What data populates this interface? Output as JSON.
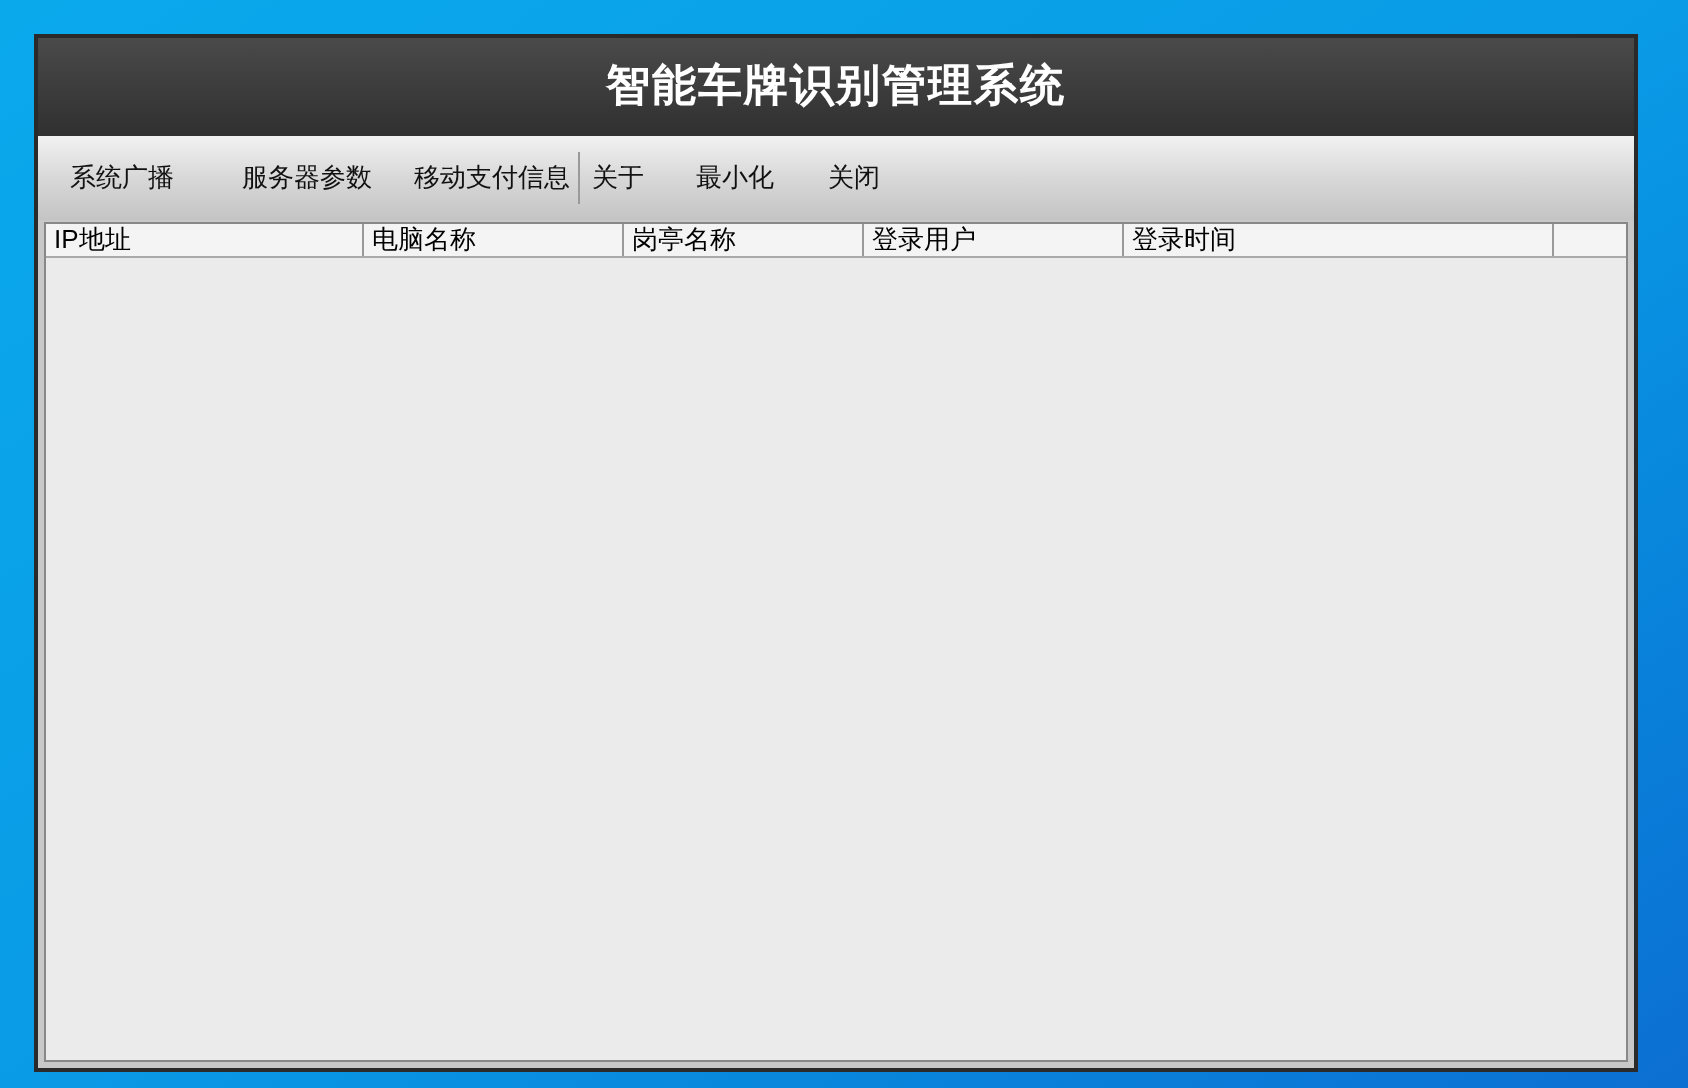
{
  "window": {
    "title": "智能车牌识别管理系统"
  },
  "toolbar": {
    "groups": [
      [
        "系统广播",
        "服务器参数",
        "移动支付信息"
      ],
      [
        "关于",
        "最小化",
        "关闭"
      ]
    ]
  },
  "table": {
    "columns": [
      "IP地址",
      "电脑名称",
      "岗亭名称",
      "登录用户",
      "登录时间"
    ]
  }
}
